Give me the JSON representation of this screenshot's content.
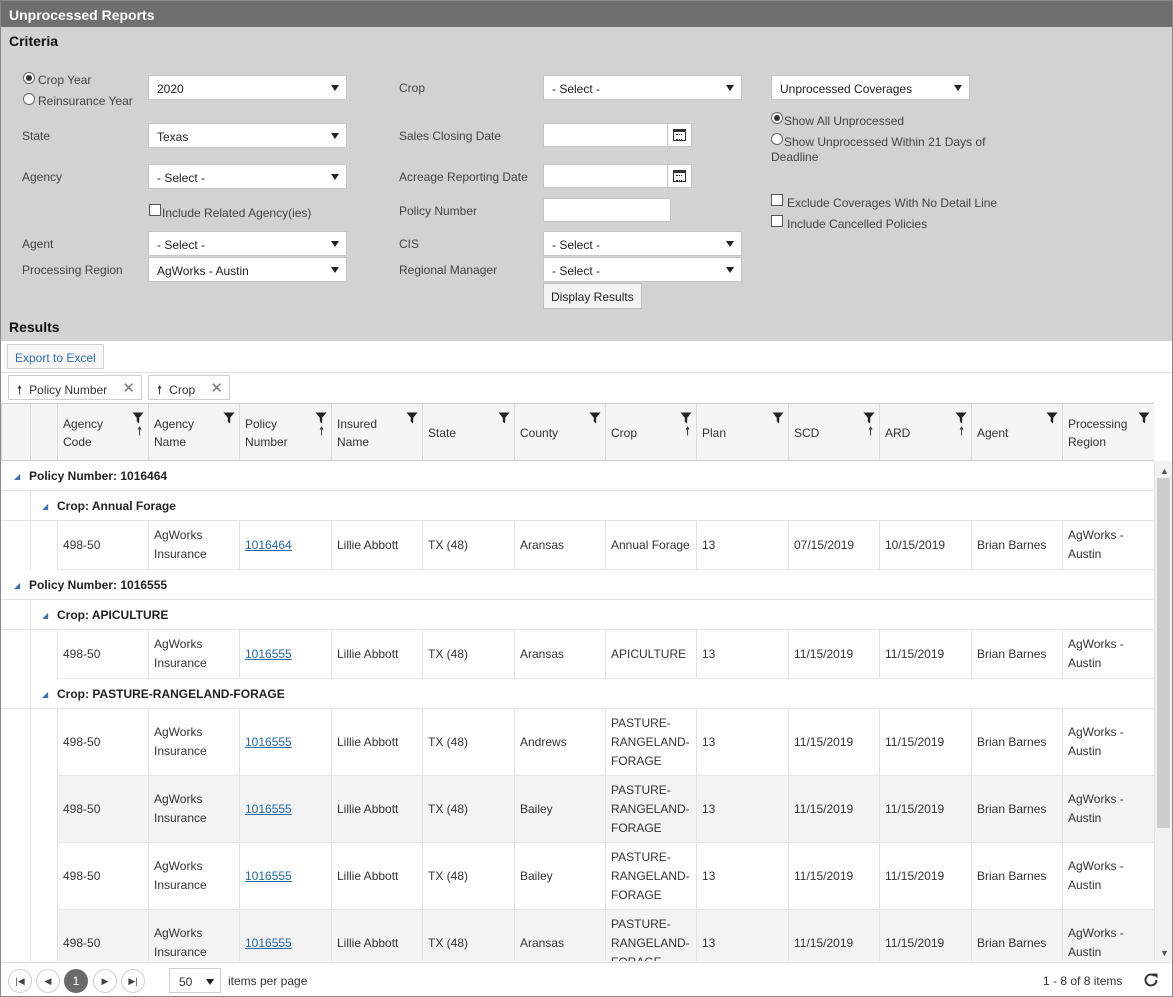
{
  "title": "Unprocessed Reports",
  "criteria": {
    "header": "Criteria",
    "year_radio": {
      "crop_year": "Crop Year",
      "reinsurance_year": "Reinsurance Year",
      "selected": "Crop Year"
    },
    "year_value": "2020",
    "state_label": "State",
    "state_value": "Texas",
    "agency_label": "Agency",
    "agency_value": "- Select -",
    "include_related_agencies": "Include Related Agency(ies)",
    "agent_label": "Agent",
    "agent_value": "- Select -",
    "processing_region_label": "Processing Region",
    "processing_region_value": "AgWorks - Austin",
    "crop_label": "Crop",
    "crop_value": "- Select -",
    "sales_closing_label": "Sales Closing Date",
    "acreage_reporting_label": "Acreage Reporting Date",
    "policy_number_label": "Policy Number",
    "cis_label": "CIS",
    "cis_value": "- Select -",
    "regional_manager_label": "Regional Manager",
    "regional_manager_value": "- Select -",
    "display_results": "Display Results",
    "coverage_type_value": "Unprocessed Coverages",
    "show_all": "Show All Unprocessed",
    "show_within": "Show Unprocessed Within 21 Days of Deadline",
    "exclude_no_detail": "Exclude Coverages With No Detail Line",
    "include_cancelled": "Include Cancelled Policies"
  },
  "results": {
    "header": "Results",
    "export_excel": "Export to Excel",
    "group_chips": [
      "Policy Number",
      "Crop"
    ],
    "columns": [
      {
        "label": "Agency Code",
        "sort": "up"
      },
      {
        "label": "Agency Name"
      },
      {
        "label": "Policy Number",
        "sort": "up"
      },
      {
        "label": "Insured Name"
      },
      {
        "label": "State"
      },
      {
        "label": "County"
      },
      {
        "label": "Crop",
        "sort": "up"
      },
      {
        "label": "Plan"
      },
      {
        "label": "SCD",
        "sort": "up"
      },
      {
        "label": "ARD",
        "sort": "up"
      },
      {
        "label": "Agent"
      },
      {
        "label": "Processing Region"
      }
    ],
    "groups": [
      {
        "policy_label": "Policy Number: 1016464",
        "crops": [
          {
            "crop_label": "Crop: Annual Forage",
            "rows": [
              [
                "498-50",
                "AgWorks Insurance",
                "1016464",
                "Lillie Abbott",
                "TX (48)",
                "Aransas",
                "Annual Forage",
                "13",
                "07/15/2019",
                "10/15/2019",
                "Brian Barnes",
                "AgWorks - Austin"
              ]
            ]
          }
        ]
      },
      {
        "policy_label": "Policy Number: 1016555",
        "crops": [
          {
            "crop_label": "Crop: APICULTURE",
            "rows": [
              [
                "498-50",
                "AgWorks Insurance",
                "1016555",
                "Lillie Abbott",
                "TX (48)",
                "Aransas",
                "APICULTURE",
                "13",
                "11/15/2019",
                "11/15/2019",
                "Brian Barnes",
                "AgWorks - Austin"
              ]
            ]
          },
          {
            "crop_label": "Crop: PASTURE-RANGELAND-FORAGE",
            "rows": [
              [
                "498-50",
                "AgWorks Insurance",
                "1016555",
                "Lillie Abbott",
                "TX (48)",
                "Andrews",
                "PASTURE-RANGELAND-FORAGE",
                "13",
                "11/15/2019",
                "11/15/2019",
                "Brian Barnes",
                "AgWorks - Austin"
              ],
              [
                "498-50",
                "AgWorks Insurance",
                "1016555",
                "Lillie Abbott",
                "TX (48)",
                "Bailey",
                "PASTURE-RANGELAND-FORAGE",
                "13",
                "11/15/2019",
                "11/15/2019",
                "Brian Barnes",
                "AgWorks - Austin"
              ],
              [
                "498-50",
                "AgWorks Insurance",
                "1016555",
                "Lillie Abbott",
                "TX (48)",
                "Bailey",
                "PASTURE-RANGELAND-FORAGE",
                "13",
                "11/15/2019",
                "11/15/2019",
                "Brian Barnes",
                "AgWorks - Austin"
              ],
              [
                "498-50",
                "AgWorks Insurance",
                "1016555",
                "Lillie Abbott",
                "TX (48)",
                "Aransas",
                "PASTURE-RANGELAND-FORAGE",
                "13",
                "11/15/2019",
                "11/15/2019",
                "Brian Barnes",
                "AgWorks - Austin"
              ]
            ]
          }
        ]
      }
    ]
  },
  "pager": {
    "current_page": "1",
    "page_size": "50",
    "items_per_page": "items per page",
    "summary": "1 - 8 of 8 items"
  },
  "colors": {
    "titlebar": "#6f6f6f",
    "criteria_bg": "#d2d2d2",
    "link": "#2166a6",
    "expand_arrow": "#3a73b5"
  },
  "icons": [
    "calendar-icon",
    "filter-icon",
    "sort-up-icon",
    "close-icon",
    "first-page-icon",
    "prev-page-icon",
    "next-page-icon",
    "last-page-icon",
    "refresh-icon",
    "scroll-up-icon",
    "scroll-down-icon"
  ]
}
